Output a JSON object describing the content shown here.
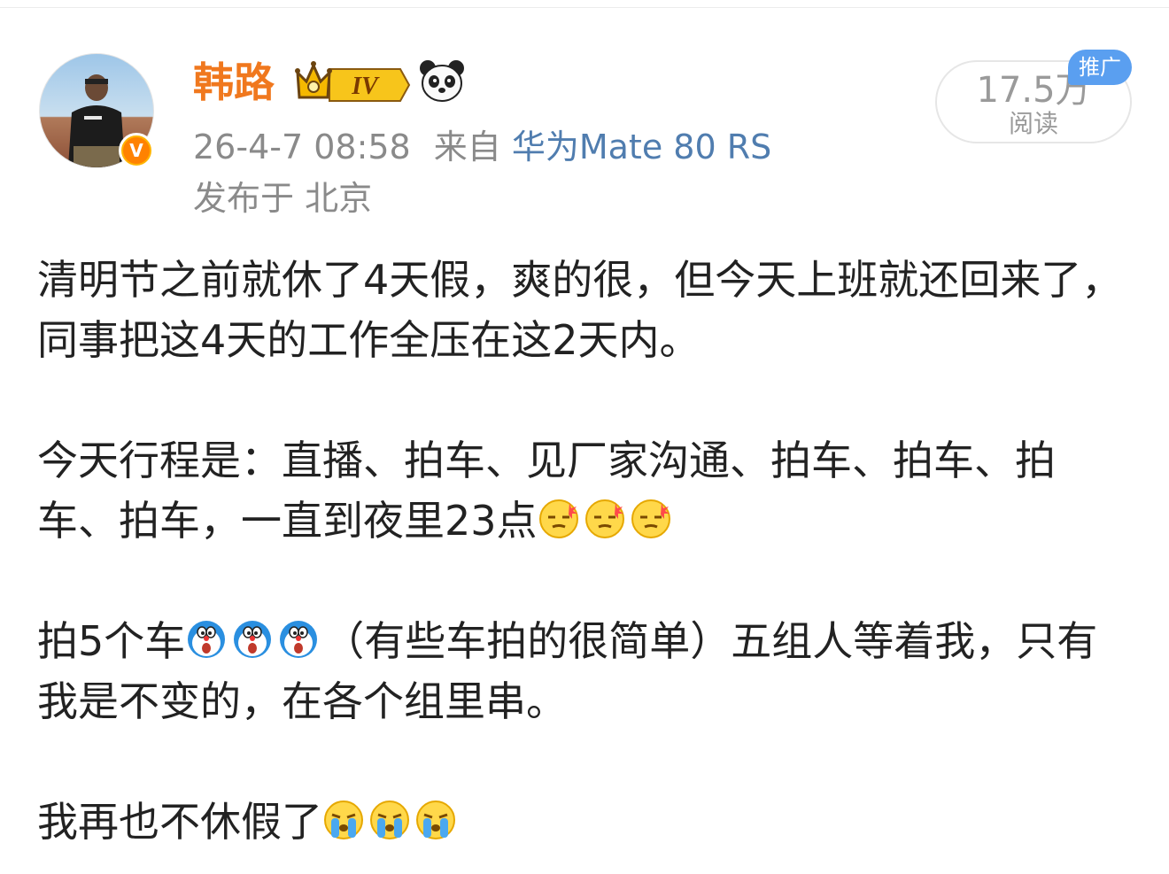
{
  "author": {
    "name": "韩路",
    "level": "IV",
    "verified_mark": "V",
    "icons": [
      "crown-level-badge-icon",
      "panda-icon",
      "verified-v-icon"
    ]
  },
  "post_meta": {
    "timestamp": "26-4-7 08:58",
    "source_prefix": "来自",
    "device": "华为Mate 80 RS",
    "location": "发布于 北京"
  },
  "reads": {
    "count": "17.5万",
    "label": "阅读",
    "promo_label": "推广"
  },
  "body": {
    "p1": "清明节之前就休了4天假，爽的很，但今天上班就还回来了，同事把这4天的工作全压在这2天内。",
    "p2": "今天行程是：直播、拍车、见厂家沟通、拍车、拍车、拍车、拍车，一直到夜里23点",
    "p3_before": "拍5个车",
    "p3_after": "（有些车拍的很简单）五组人等着我，只有我是不变的，在各个组里串。",
    "p4": "我再也不休假了",
    "emoji": {
      "p2": [
        "annoyed-face-icon",
        "annoyed-face-icon",
        "annoyed-face-icon"
      ],
      "p3": [
        "doraemon-face-icon",
        "doraemon-face-icon",
        "doraemon-face-icon"
      ],
      "p4": [
        "crying-face-icon",
        "crying-face-icon",
        "crying-face-icon"
      ]
    }
  },
  "colors": {
    "username": "#f0781e",
    "device_link": "#507daf",
    "meta_text": "#8a8a8a",
    "promo_badge": "#5a9ff0",
    "verified_badge": "#ff8200"
  }
}
